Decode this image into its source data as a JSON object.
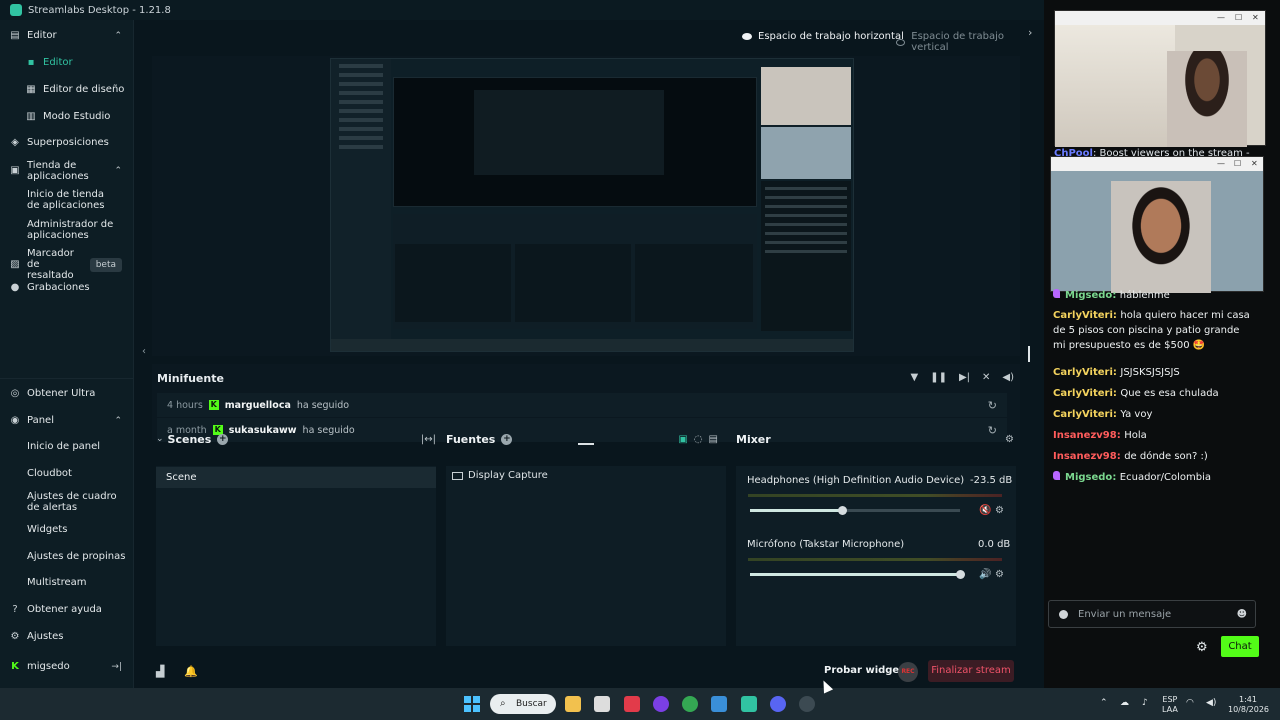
{
  "titlebar": {
    "title": "Streamlabs Desktop - 1.21.8"
  },
  "sidebar": {
    "editor": "Editor",
    "editor_sub": "Editor",
    "editor_diseno": "Editor de diseño",
    "modo_estudio": "Modo Estudio",
    "superposiciones": "Superposiciones",
    "tienda": "Tienda de aplicaciones",
    "inicio_tienda": "Inicio de tienda de aplicaciones",
    "admin_apps": "Administrador de aplicaciones",
    "marcador": "Marcador de resaltado",
    "marcador_badge": "beta",
    "grabaciones": "Grabaciones",
    "obtener_ultra": "Obtener Ultra",
    "panel": "Panel",
    "inicio_panel": "Inicio de panel",
    "cloudbot": "Cloudbot",
    "ajustes_alertas": "Ajustes de cuadro de alertas",
    "widgets": "Widgets",
    "ajustes_propinas": "Ajustes de propinas",
    "multistream": "Multistream",
    "obtener_ayuda": "Obtener ayuda",
    "ajustes": "Ajustes",
    "user": "migsedo"
  },
  "workspace": {
    "horizontal": "Espacio de trabajo horizontal",
    "vertical": "Espacio de trabajo vertical"
  },
  "minifuente": {
    "title": "Minifuente",
    "events": [
      {
        "time": "4 hours",
        "user": "marguelloca",
        "action": "ha seguido"
      },
      {
        "time": "a month",
        "user": "sukasukaww",
        "action": "ha seguido"
      }
    ]
  },
  "scenes": {
    "title": "Scenes",
    "items": [
      "Scene"
    ]
  },
  "fuentes": {
    "title": "Fuentes",
    "items": [
      "Display Capture"
    ]
  },
  "mixer": {
    "title": "Mixer",
    "channels": [
      {
        "name": "Headphones (High Definition Audio Device)",
        "db": "-23.5 dB",
        "level": 0.44
      },
      {
        "name": "Micrófono (Takstar Microphone)",
        "db": "0.0 dB",
        "level": 1.0
      }
    ]
  },
  "footer": {
    "probar": "Probar widgets",
    "rec": "REC",
    "finalizar": "Finalizar stream"
  },
  "right": {
    "boost_user": "ChPool",
    "boost_text": ": Boost viewers on the stream -",
    "chat": [
      {
        "user": "Migsedo",
        "text": "háblenme",
        "color": "green",
        "pin": true
      },
      {
        "user": "CarlyViteri",
        "text": "hola quiero hacer mi casa de 5 pisos con piscina y patio grande mi presupuesto es de $500 🤩",
        "color": "yellow",
        "pin": false
      },
      {
        "user": "CarlyViteri",
        "text": "JSJSKSJSJSJS",
        "color": "yellow",
        "pin": false
      },
      {
        "user": "CarlyViteri",
        "text": "Que es esa chulada",
        "color": "yellow",
        "pin": false
      },
      {
        "user": "CarlyViteri",
        "text": "Ya voy",
        "color": "yellow",
        "pin": false
      },
      {
        "user": "Insanezv98",
        "text": "Hola",
        "color": "red",
        "pin": false
      },
      {
        "user": "Insanezv98",
        "text": "de dónde son? :)",
        "color": "red",
        "pin": false
      },
      {
        "user": "Migsedo",
        "text": "Ecuador/Colombia",
        "color": "green",
        "pin": true
      }
    ],
    "input_placeholder": "Enviar un mensaje",
    "chat_button": "Chat"
  },
  "taskbar": {
    "search": "Buscar",
    "lang1": "ESP",
    "lang2": "LAA",
    "time": "1:41",
    "date": "10/8/2026"
  },
  "colors": {
    "accent": "#31c3a2",
    "kick": "#53fc18",
    "danger": "#ef5369"
  }
}
